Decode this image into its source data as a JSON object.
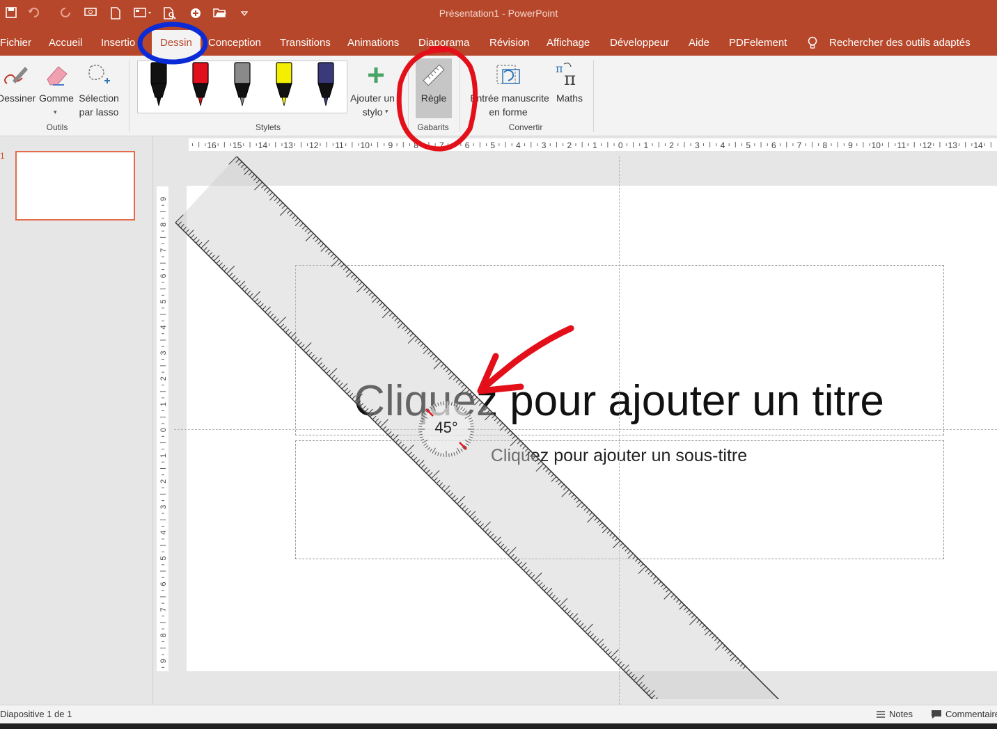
{
  "window": {
    "title": "Présentation1  -  PowerPoint"
  },
  "quick_access": {
    "icons": [
      "save-icon",
      "undo-icon",
      "redo-icon",
      "present-icon",
      "new-icon",
      "layout-icon",
      "print-preview-icon",
      "share-icon",
      "open-icon",
      "customize-icon"
    ]
  },
  "tabs": [
    "Fichier",
    "Accueil",
    "Insertio",
    "Dessin",
    "Conception",
    "Transitions",
    "Animations",
    "Diaporama",
    "Révision",
    "Affichage",
    "Développeur",
    "Aide",
    "PDFelement"
  ],
  "active_tab": "Dessin",
  "search": {
    "label": "Rechercher des outils adaptés"
  },
  "ribbon": {
    "tools": {
      "draw": "Dessiner",
      "eraser": "Gomme",
      "lasso_line1": "Sélection",
      "lasso_line2": "par lasso",
      "group": "Outils"
    },
    "pens": {
      "group": "Stylets",
      "add_line1": "Ajouter un",
      "add_line2": "stylo",
      "items": [
        {
          "color": "#111111"
        },
        {
          "color": "#e0101c"
        },
        {
          "color": "#8a8a8a"
        },
        {
          "color": "#f4ee00"
        },
        {
          "color": "#3a3a7a"
        }
      ]
    },
    "stencils": {
      "ruler": "Règle",
      "group": "Gabarits"
    },
    "convert": {
      "ink_line1": "Entrée manuscrite",
      "ink_line2": "en forme",
      "math": "Maths",
      "group": "Convertir"
    }
  },
  "thumbnails": [
    {
      "number": "1"
    }
  ],
  "slide": {
    "title_placeholder": "Cliquez pour ajouter un titre",
    "subtitle_placeholder": "Cliquez pour ajouter un sous-titre",
    "ruler_angle": "45°"
  },
  "rulers": {
    "horizontal": [
      "16",
      "15",
      "14",
      "13",
      "12",
      "11",
      "10",
      "9",
      "8",
      "7",
      "6",
      "5",
      "4",
      "3",
      "2",
      "1",
      "0",
      "1",
      "2",
      "3",
      "4",
      "5",
      "6",
      "7",
      "8",
      "9",
      "10",
      "11",
      "12",
      "13",
      "14"
    ],
    "vertical": [
      "9",
      "8",
      "7",
      "6",
      "5",
      "4",
      "3",
      "2",
      "1",
      "0",
      "1",
      "2",
      "3",
      "4",
      "5",
      "6",
      "7",
      "8",
      "9"
    ]
  },
  "status": {
    "slide_info": "Diapositive 1 de 1",
    "notes": "Notes",
    "comments": "Commentaires"
  },
  "annotations": {
    "blue_circle_color": "#0a2bd6",
    "red_color": "#e3101a"
  }
}
